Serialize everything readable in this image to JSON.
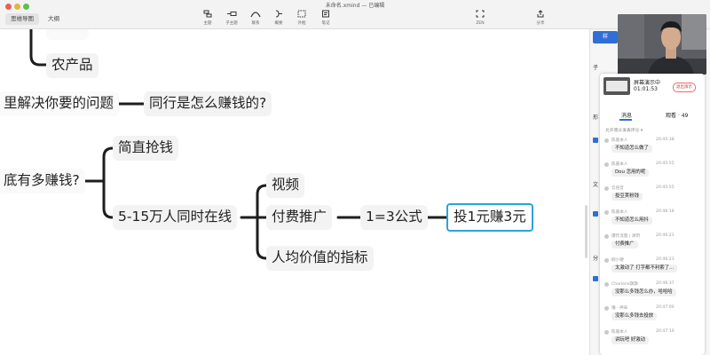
{
  "window": {
    "title": "未命名.xmind — 已编辑",
    "view_tabs": [
      "思维导图",
      "大纲"
    ]
  },
  "toolbar": {
    "tools": [
      {
        "label": "主题",
        "icon": "topic-icon"
      },
      {
        "label": "子主题",
        "icon": "subtopic-icon"
      },
      {
        "label": "联系",
        "icon": "relationship-icon"
      },
      {
        "label": "概要",
        "icon": "summary-icon"
      },
      {
        "label": "外框",
        "icon": "boundary-icon"
      },
      {
        "label": "笔记",
        "icon": "note-icon"
      }
    ],
    "zen_label": "ZEN",
    "share_label": "分享"
  },
  "mindmap": {
    "nodes": {
      "agri": "农产品",
      "solve": "里解决你要的问题",
      "peers": "同行是怎么赚钱的?",
      "money": "底有多赚钱?",
      "simple": "简直抢钱",
      "users": "5-15万人同时在线",
      "video": "视频",
      "paid": "付费推广",
      "formula": "1=3公式",
      "invest": "投1元赚3元",
      "value": "人均价值的指标"
    }
  },
  "right_panel": {
    "blue_tab_label": "样",
    "side_label_1": "子",
    "side_label_2": "形",
    "side_label_3": "文",
    "side_label_4": "分"
  },
  "live": {
    "status_label": "屏幕演示中",
    "elapsed": "01:01:53",
    "exit_label": "退出演示",
    "tab_messages": "消息",
    "tab_viewers": "观看 · 49",
    "filter_label": "允许观众发表评论 ▾",
    "messages": [
      {
        "user": "陈嘉本人",
        "time": "20:45:38",
        "text": "不知道怎么做了"
      },
      {
        "user": "陈嘉本人",
        "time": "20:45:55",
        "text": "Dou    怎用的呢"
      },
      {
        "user": "云倍音",
        "time": "20:45:55",
        "text": "投豆荚粉钱"
      },
      {
        "user": "陈嘉本人",
        "time": "20:46:16",
        "text": "不知道怎么用抖"
      },
      {
        "user": "爆炸流量 | 清玥",
        "time": "20:46:21",
        "text": "付费推广"
      },
      {
        "user": "柳少硬",
        "time": "20:46:23",
        "text": "太激动了  打字都不利索了…"
      },
      {
        "user": "Charlene飘飘",
        "time": "20:46:37",
        "text": "没那么多钱怎么办，哈哈哈"
      },
      {
        "user": "懂 · 神采",
        "time": "20:47:00",
        "text": "没那么多钱去投放"
      },
      {
        "user": "陈嘉本人",
        "time": "20:47:10",
        "text": "讲玩吧  好激动"
      }
    ]
  },
  "colors": {
    "selected_border": "#2aa4d8",
    "accent_blue": "#2f6fd6",
    "line": "#1e1e1e"
  }
}
